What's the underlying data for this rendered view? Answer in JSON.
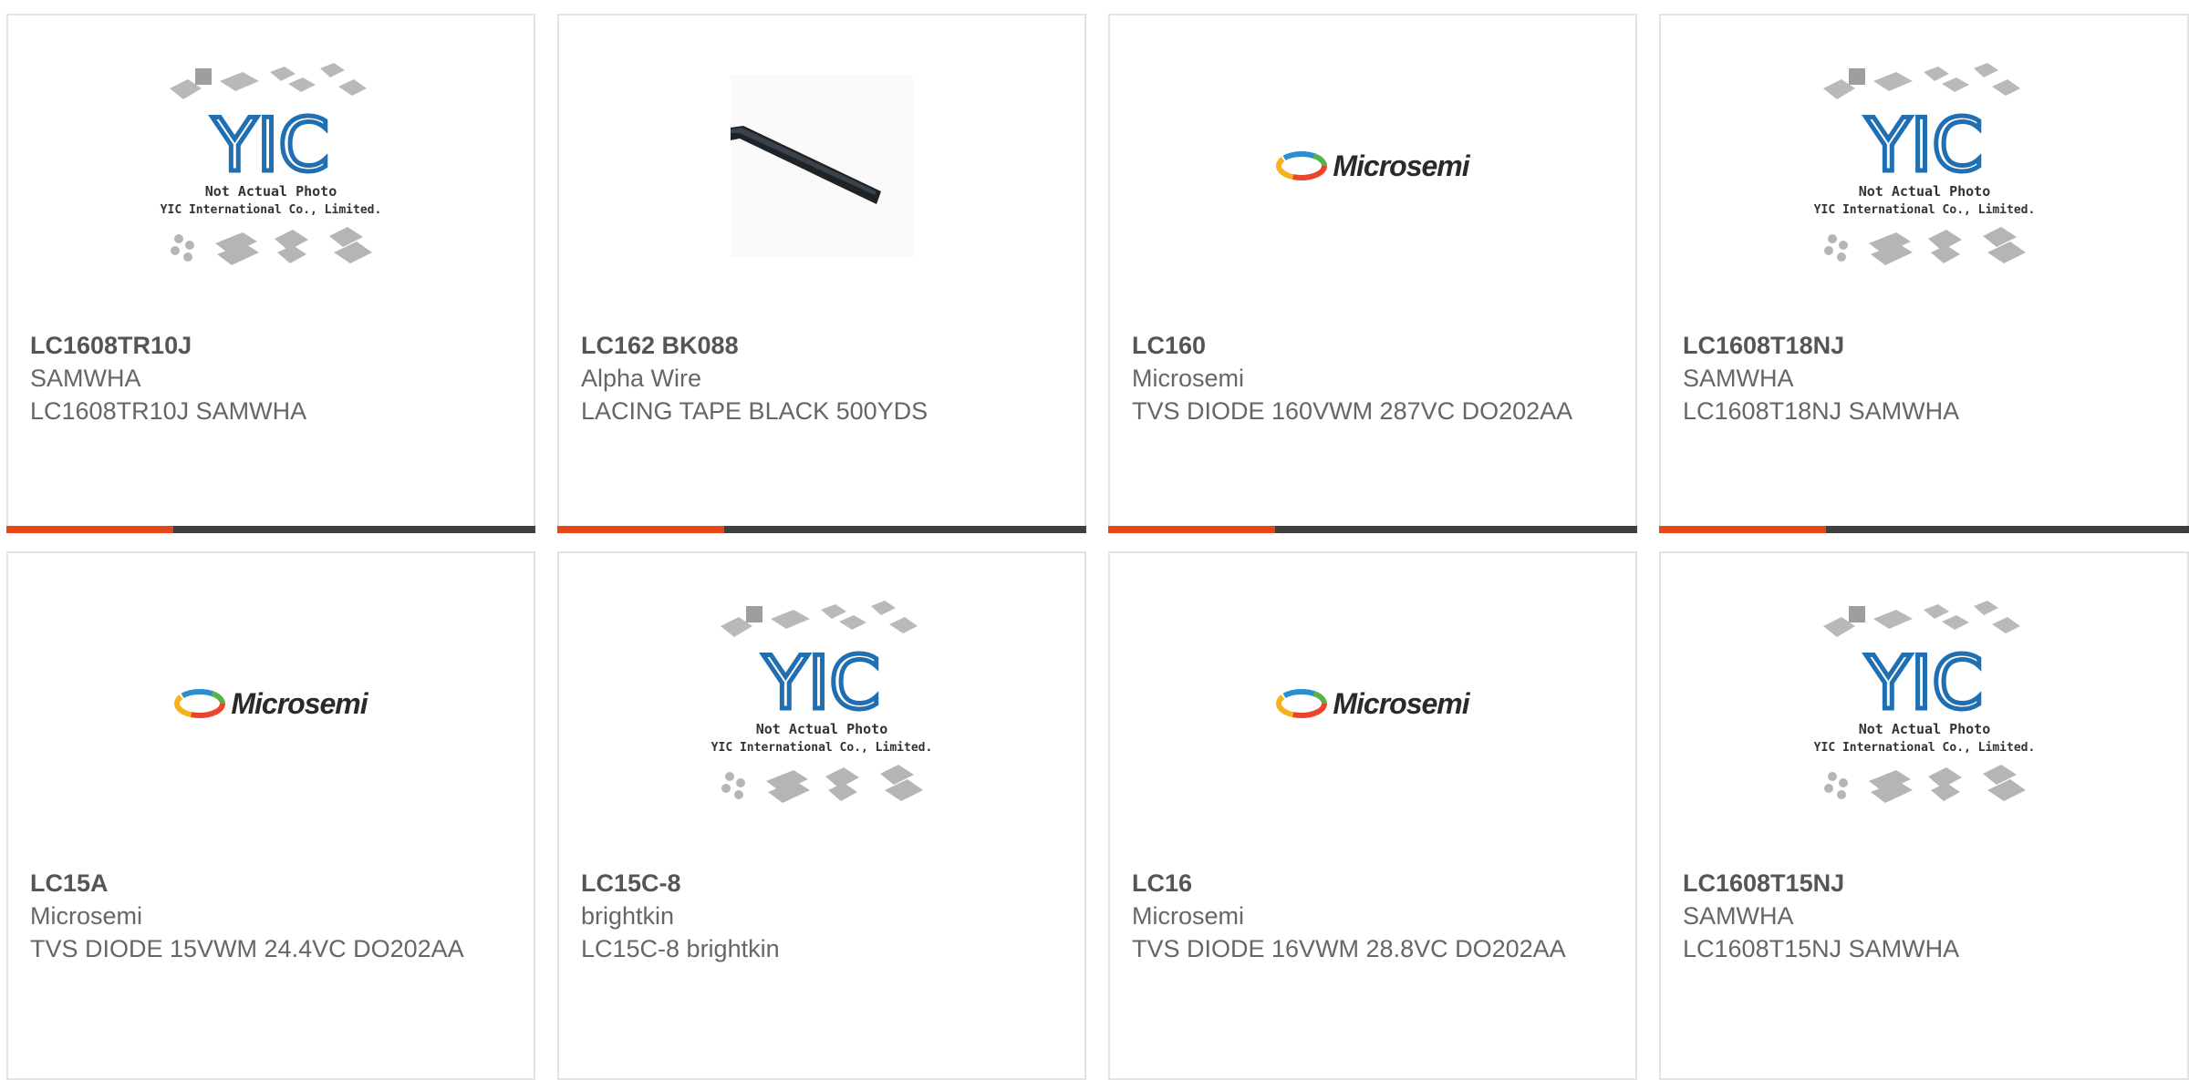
{
  "products": [
    {
      "part": "LC1608TR10J",
      "manufacturer": "SAMWHA",
      "description": "LC1608TR10J SAMWHA",
      "image": "yic-placeholder"
    },
    {
      "part": "LC162 BK088",
      "manufacturer": "Alpha Wire",
      "description": "LACING TAPE BLACK 500YDS",
      "image": "lacing-tape-photo"
    },
    {
      "part": "LC160",
      "manufacturer": "Microsemi",
      "description": "TVS DIODE 160VWM 287VC DO202AA",
      "image": "microsemi-logo"
    },
    {
      "part": "LC1608T18NJ",
      "manufacturer": "SAMWHA",
      "description": "LC1608T18NJ SAMWHA",
      "image": "yic-placeholder"
    },
    {
      "part": "LC15A",
      "manufacturer": "Microsemi",
      "description": "TVS DIODE 15VWM 24.4VC DO202AA",
      "image": "microsemi-logo"
    },
    {
      "part": "LC15C-8",
      "manufacturer": "brightkin",
      "description": "LC15C-8 brightkin",
      "image": "yic-placeholder"
    },
    {
      "part": "LC16",
      "manufacturer": "Microsemi",
      "description": "TVS DIODE 16VWM 28.8VC DO202AA",
      "image": "microsemi-logo"
    },
    {
      "part": "LC1608T15NJ",
      "manufacturer": "SAMWHA",
      "description": "LC1608T15NJ SAMWHA",
      "image": "yic-placeholder"
    }
  ],
  "placeholder": {
    "logo_text": "YIC",
    "line1": "Not Actual Photo",
    "line2": "YIC International Co., Limited."
  },
  "microsemi_logo_text": "Microsemi",
  "colors": {
    "accent": "#e54717",
    "bar": "#3f3f3f",
    "border": "#e3e3e3",
    "yic_blue": "#1f6fb2"
  }
}
